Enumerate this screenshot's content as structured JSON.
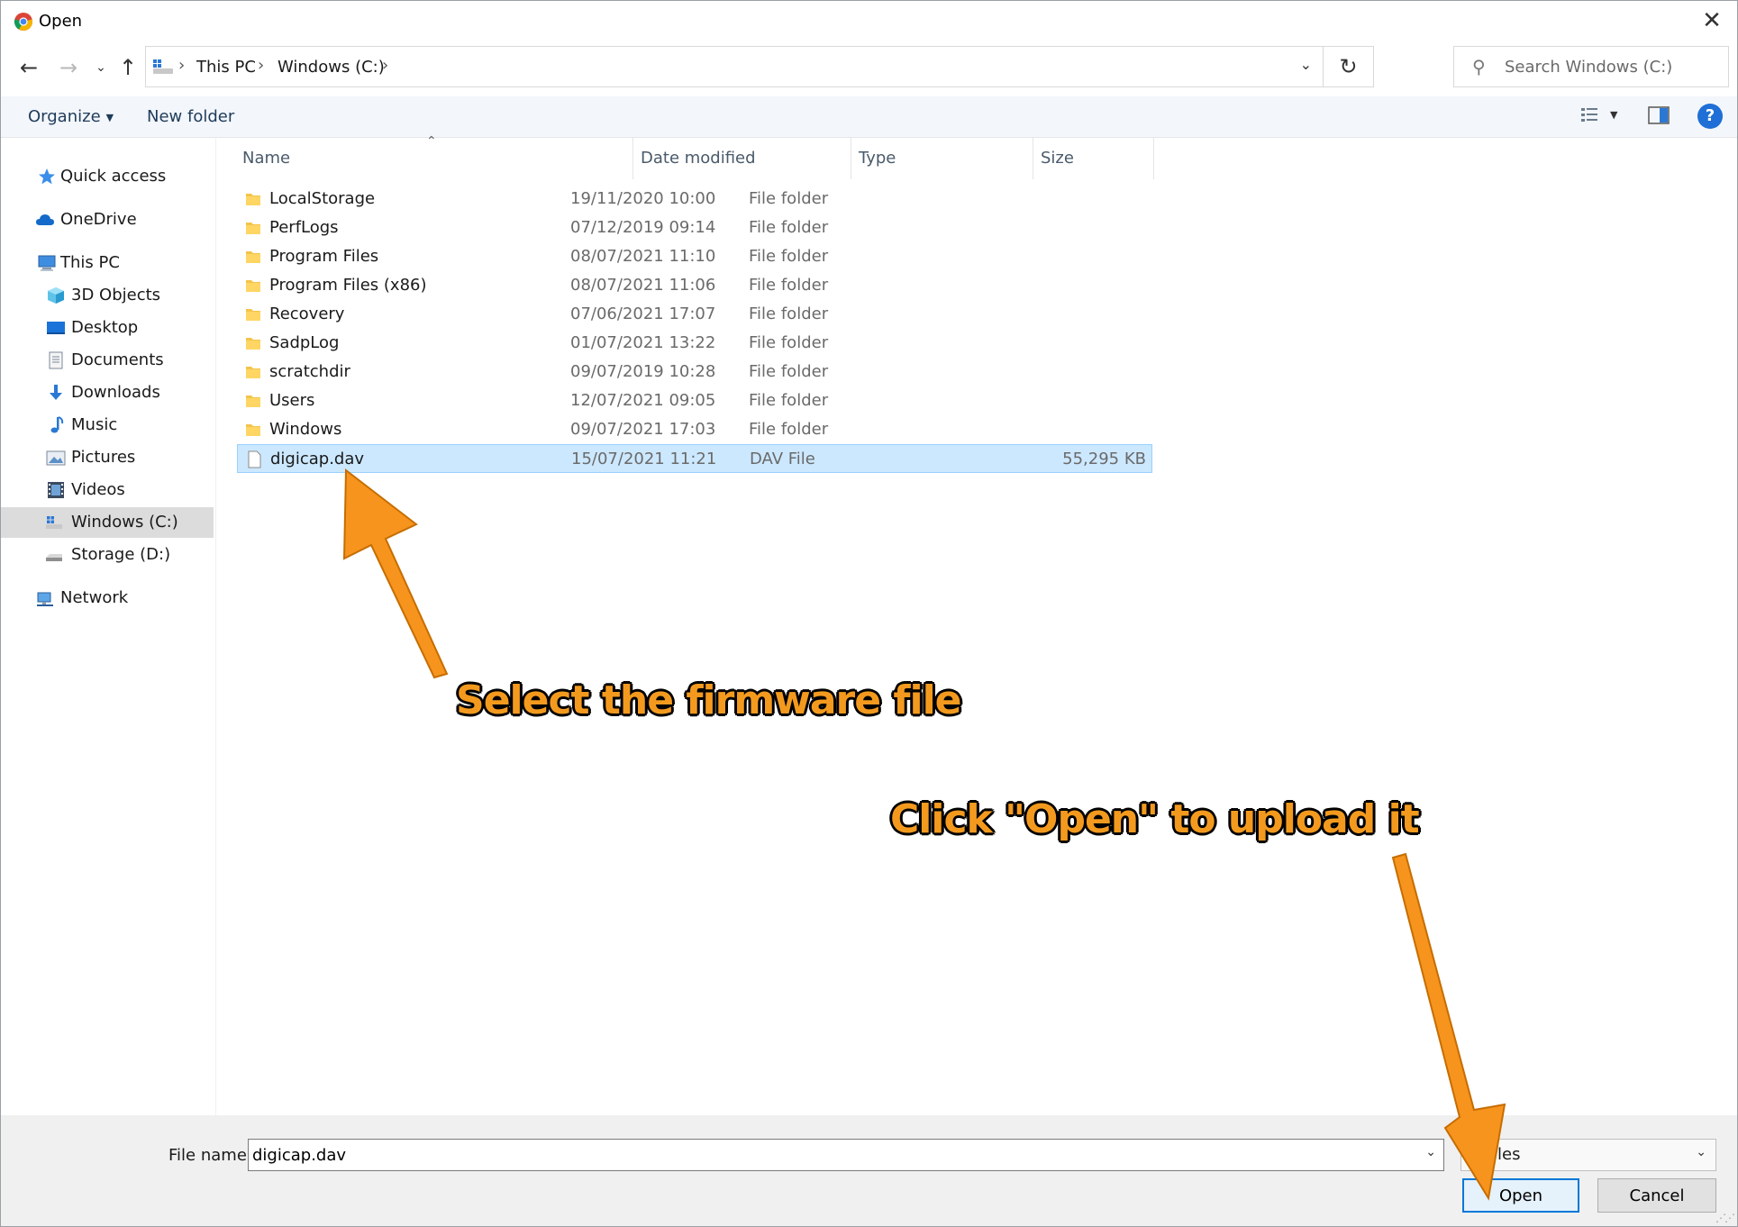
{
  "window": {
    "title": "Open",
    "close_glyph": "✕"
  },
  "address": {
    "breadcrumbs": [
      "This PC",
      "Windows (C:)"
    ],
    "search_placeholder": "Search Windows (C:)"
  },
  "commands": {
    "organize": "Organize",
    "new_folder": "New folder"
  },
  "nav": {
    "items": [
      {
        "label": "Quick access",
        "icon": "star-icon"
      },
      {
        "label": "OneDrive",
        "icon": "cloud-icon"
      },
      {
        "label": "This PC",
        "icon": "computer-icon"
      },
      {
        "label": "3D Objects",
        "icon": "cube-icon"
      },
      {
        "label": "Desktop",
        "icon": "desktop-icon"
      },
      {
        "label": "Documents",
        "icon": "document-icon"
      },
      {
        "label": "Downloads",
        "icon": "download-icon"
      },
      {
        "label": "Music",
        "icon": "music-icon"
      },
      {
        "label": "Pictures",
        "icon": "pictures-icon"
      },
      {
        "label": "Videos",
        "icon": "video-icon"
      },
      {
        "label": "Windows (C:)",
        "icon": "drive-icon"
      },
      {
        "label": "Storage (D:)",
        "icon": "drive-icon"
      },
      {
        "label": "Network",
        "icon": "network-icon"
      }
    ]
  },
  "columns": {
    "name": "Name",
    "date": "Date modified",
    "type": "Type",
    "size": "Size"
  },
  "files": [
    {
      "name": "LocalStorage",
      "date": "19/11/2020 10:00",
      "type": "File folder",
      "size": ""
    },
    {
      "name": "PerfLogs",
      "date": "07/12/2019 09:14",
      "type": "File folder",
      "size": ""
    },
    {
      "name": "Program Files",
      "date": "08/07/2021 11:10",
      "type": "File folder",
      "size": ""
    },
    {
      "name": "Program Files (x86)",
      "date": "08/07/2021 11:06",
      "type": "File folder",
      "size": ""
    },
    {
      "name": "Recovery",
      "date": "07/06/2021 17:07",
      "type": "File folder",
      "size": ""
    },
    {
      "name": "SadpLog",
      "date": "01/07/2021 13:22",
      "type": "File folder",
      "size": ""
    },
    {
      "name": "scratchdir",
      "date": "09/07/2019 10:28",
      "type": "File folder",
      "size": ""
    },
    {
      "name": "Users",
      "date": "12/07/2021 09:05",
      "type": "File folder",
      "size": ""
    },
    {
      "name": "Windows",
      "date": "09/07/2021 17:03",
      "type": "File folder",
      "size": ""
    },
    {
      "name": "digicap.dav",
      "date": "15/07/2021 11:21",
      "type": "DAV File",
      "size": "55,295 KB"
    }
  ],
  "footer": {
    "file_name_label": "File name:",
    "file_name_value": "digicap.dav",
    "file_type_visible": "les",
    "open_label": "Open",
    "cancel_label": "Cancel"
  },
  "annotations": {
    "select_text": "Select the firmware file",
    "open_text": "Click \"Open\" to upload it",
    "color": "#f39a1e"
  }
}
